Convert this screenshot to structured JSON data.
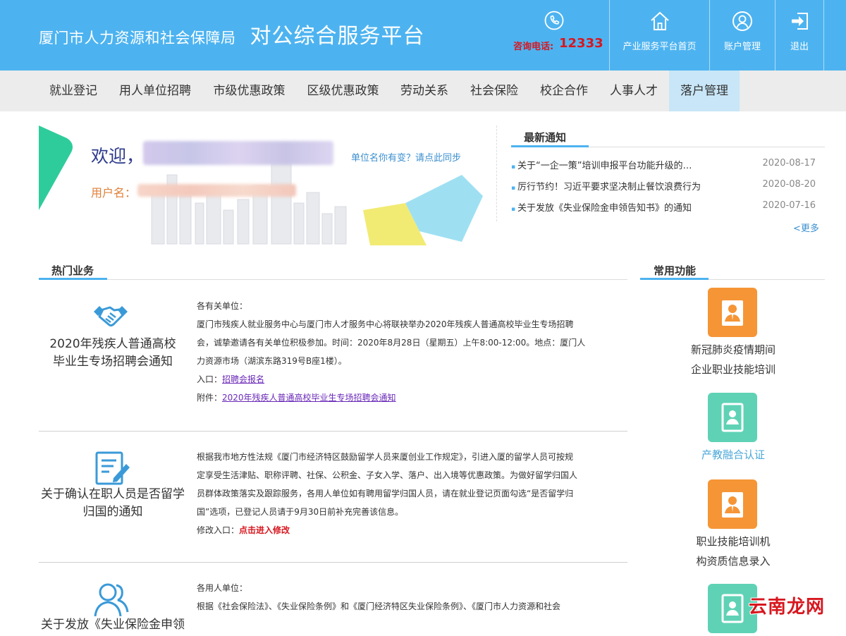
{
  "header": {
    "bureau": "厦门市人力资源和社会保障局",
    "platform": "对公综合服务平台",
    "hotline_label": "咨询电话:",
    "hotline_number": "12333",
    "buttons": [
      {
        "label": "产业服务平台首页",
        "icon": "home-icon"
      },
      {
        "label": "账户管理",
        "icon": "user-icon"
      },
      {
        "label": "退出",
        "icon": "logout-icon"
      }
    ]
  },
  "nav": {
    "items": [
      "就业登记",
      "用人单位招聘",
      "市级优惠政策",
      "区级优惠政策",
      "劳动关系",
      "社会保险",
      "校企合作",
      "人事人才",
      "落户管理"
    ],
    "active": "落户管理"
  },
  "welcome": {
    "greeting": "欢迎，",
    "sync_link": "单位名你有变？请点此同步",
    "username_label": "用户名："
  },
  "notices": {
    "title": "最新通知",
    "items": [
      {
        "title": "关于“一企一策”培训申报平台功能升级的…",
        "date": "2020-08-17"
      },
      {
        "title": "厉行节约！习近平要求坚决制止餐饮浪费行为",
        "date": "2020-08-20"
      },
      {
        "title": "关于发放《失业保险金申领告知书》的通知",
        "date": "2020-07-16"
      }
    ],
    "more": "<更多"
  },
  "hot_business": {
    "title": "热门业务",
    "items": [
      {
        "title_line1": "2020年残疾人普通高校",
        "title_line2": "毕业生专场招聘会通知",
        "icon": "handshake-icon",
        "greeting": "各有关单位：",
        "body_lines": [
          "厦门市残疾人就业服务中心与厦门市人才服务中心将联袂举办2020年残疾人普通高校毕业生专场招聘",
          "会，诚挚邀请各有关单位积极参加。时间：2020年8月28日（星期五）上午8:00-12:00。地点：厦门人",
          "力资源市场（湖滨东路319号B座1楼）。"
        ],
        "entry_label": "入口：",
        "entry_link": "招聘会报名",
        "attach_label": "附件：",
        "attach_link": "2020年残疾人普通高校毕业生专场招聘会通知"
      },
      {
        "title_line1": "关于确认在职人员是否留学",
        "title_line2": "归国的通知",
        "icon": "edit-document-icon",
        "body_lines": [
          "根据我市地方性法规《厦门市经济特区鼓励留学人员来厦创业工作规定》，引进入厦的留学人员可按规",
          "定享受生活津贴、职称评聘、社保、公积金、子女入学、落户、出入境等优惠政策。为做好留学归国人",
          "员群体政策落实及跟踪服务，各用人单位如有聘用留学归国人员，请在就业登记页面勾选“是否留学归",
          "国”选项，已登记人员请于9月30日前补充完善该信息。"
        ],
        "entry_label": "修改入口：",
        "entry_link": "点击进入修改"
      },
      {
        "title_line1": "关于发放《失业保险金申领",
        "icon": "users-icon",
        "greeting": "各用人单位：",
        "body_lines": [
          "根据《社会保险法》、《失业保险条例》和《厦门经济特区失业保险条例》、《厦门市人力资源和社会"
        ]
      }
    ]
  },
  "common_functions": {
    "title": "常用功能",
    "items": [
      {
        "line1": "新冠肺炎疫情期间",
        "line2": "企业职业技能培训",
        "color": "#f59536",
        "icon": "person-badge-icon"
      },
      {
        "line1": "产教融合认证",
        "line2": "",
        "color": "#5fd2b5",
        "icon": "id-card-icon"
      },
      {
        "line1": "职业技能培训机",
        "line2": "构资质信息录入",
        "color": "#f59536",
        "icon": "person-badge-icon"
      },
      {
        "line1": "",
        "line2": "",
        "color": "#5fd2b5",
        "icon": "id-card-icon"
      }
    ]
  },
  "watermark": "云南龙网"
}
